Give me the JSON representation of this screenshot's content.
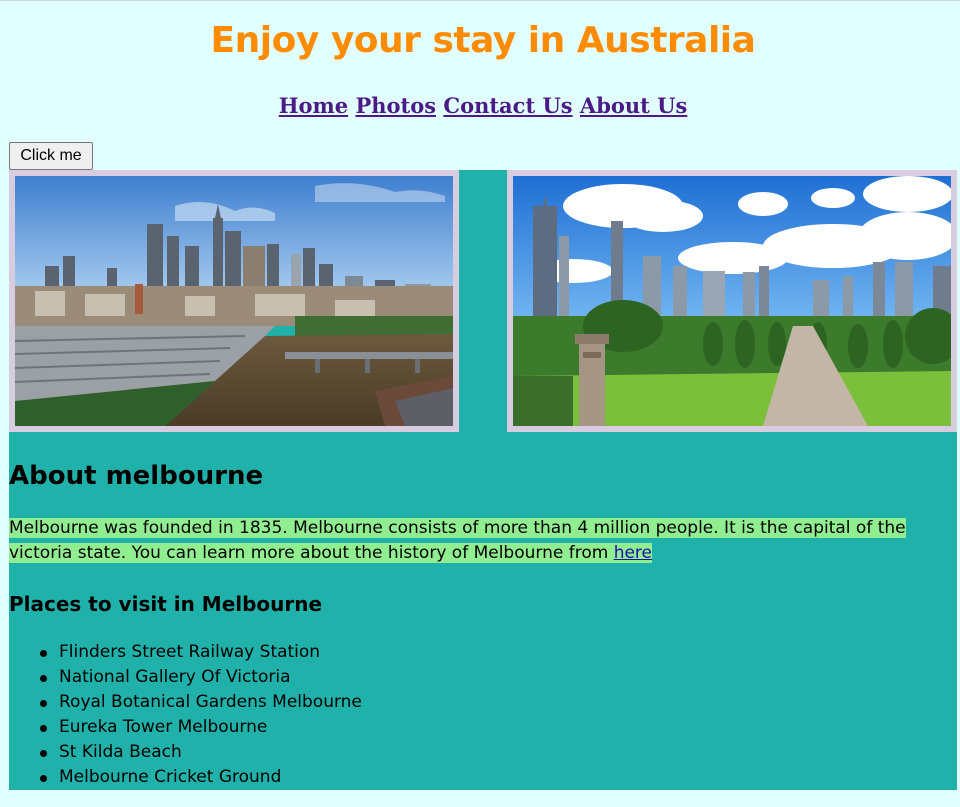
{
  "header": {
    "title": "Enjoy your stay in Australia",
    "title_color": "#ff8c00"
  },
  "nav": {
    "items": [
      {
        "label": "Home"
      },
      {
        "label": "Photos"
      },
      {
        "label": "Contact Us"
      },
      {
        "label": "About Us"
      }
    ],
    "link_color": "#4b1a86"
  },
  "button": {
    "label": "Click me"
  },
  "photos": [
    {
      "subject": "Melbourne skyline over the Yarra River and Flinders Street railyards"
    },
    {
      "subject": "Melbourne skyline viewed from the Shrine of Remembrance gardens"
    }
  ],
  "about": {
    "heading": "About melbourne",
    "text": "Melbourne was founded in 1835. Melbourne consists of more than 4 million people. It is the capital of the victoria state. You can learn more about the history of Melbourne from ",
    "link_label": "here",
    "highlight_color": "#90ee90"
  },
  "places": {
    "heading": "Places to visit in Melbourne",
    "items": [
      "Flinders Street Railway Station",
      "National Gallery Of Victoria",
      "Royal Botanical Gardens Melbourne",
      "Eureka Tower Melbourne",
      "St Kilda Beach",
      "Melbourne Cricket Ground"
    ]
  },
  "colors": {
    "page_background": "#e1ffff",
    "content_background": "#20b2aa",
    "photo_border": "#d8cde0"
  }
}
